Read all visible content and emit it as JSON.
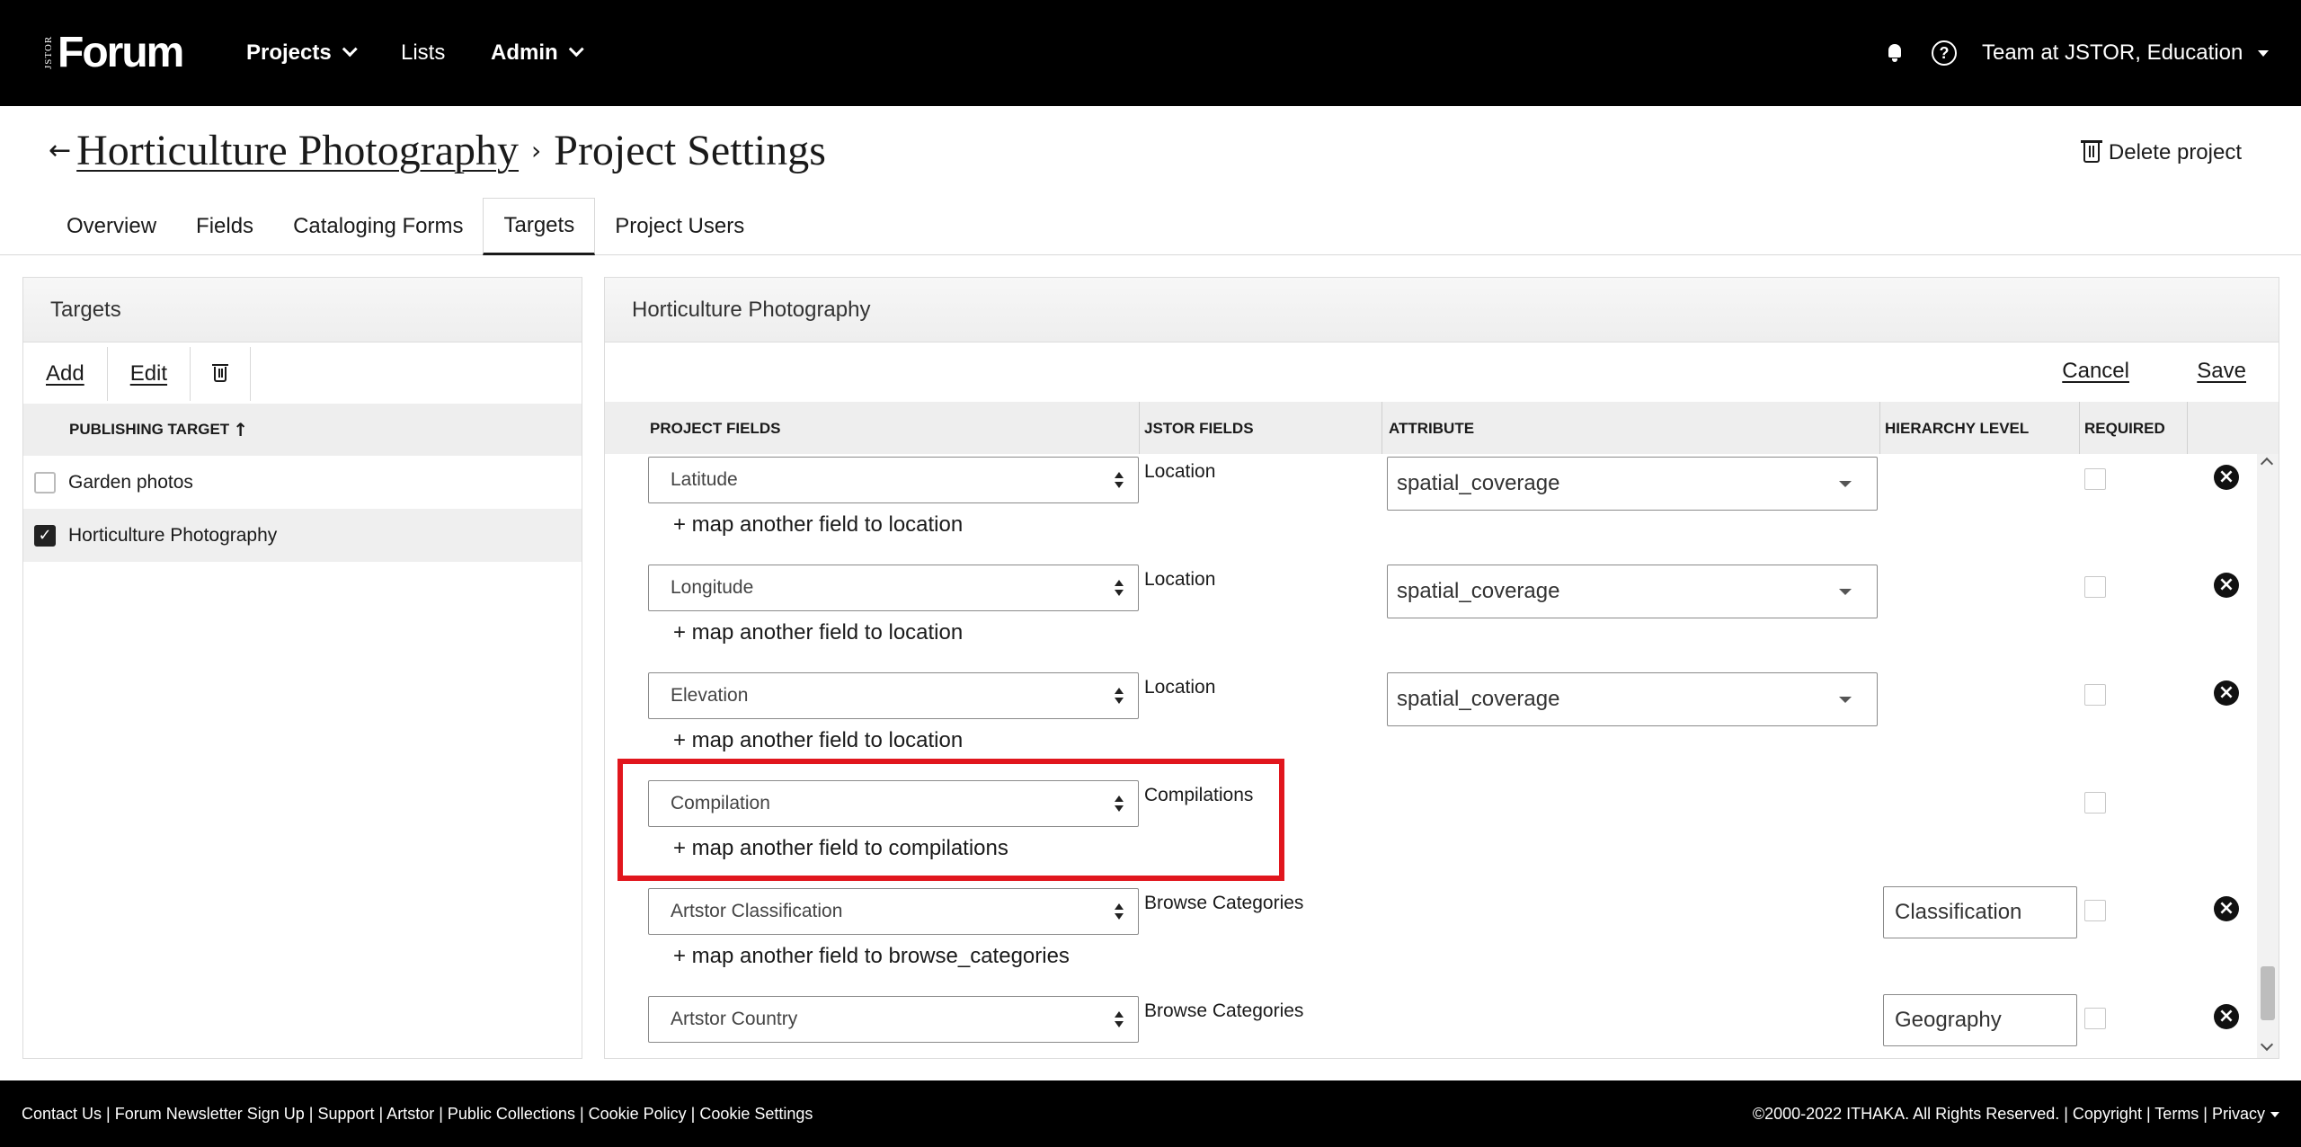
{
  "brand": {
    "small": "JSTOR",
    "main": "Forum"
  },
  "nav": {
    "projects": "Projects",
    "lists": "Lists",
    "admin": "Admin"
  },
  "user": {
    "team": "Team at JSTOR, Education",
    "help_glyph": "?"
  },
  "breadcrumb": {
    "back": "←",
    "project": "Horticulture Photography",
    "separator": "›",
    "current": "Project Settings"
  },
  "delete_project": "Delete project",
  "tabs": [
    "Overview",
    "Fields",
    "Cataloging Forms",
    "Targets",
    "Project Users"
  ],
  "active_tab": "Targets",
  "left_panel": {
    "title": "Targets",
    "toolbar": {
      "add": "Add",
      "edit": "Edit",
      "delete_icon": "trash-icon"
    },
    "column": "PUBLISHING TARGET",
    "sort_glyph": "↑",
    "rows": [
      {
        "label": "Garden photos",
        "checked": false
      },
      {
        "label": "Horticulture Photography",
        "checked": true
      }
    ]
  },
  "right_panel": {
    "title": "Horticulture Photography",
    "cancel": "Cancel",
    "save": "Save",
    "columns": {
      "project_fields": "PROJECT FIELDS",
      "jstor_fields": "JSTOR FIELDS",
      "attribute": "ATTRIBUTE",
      "hierarchy_level": "HIERARCHY LEVEL",
      "required": "REQUIRED"
    },
    "rows": [
      {
        "project_field": "Latitude",
        "jstor_field": "Location",
        "attribute": "spatial_coverage",
        "hierarchy": "",
        "map_link": "+ map another field to location",
        "removable": true
      },
      {
        "project_field": "Longitude",
        "jstor_field": "Location",
        "attribute": "spatial_coverage",
        "hierarchy": "",
        "map_link": "+ map another field to location",
        "removable": true
      },
      {
        "project_field": "Elevation",
        "jstor_field": "Location",
        "attribute": "spatial_coverage",
        "hierarchy": "",
        "map_link": "+ map another field to location",
        "removable": true
      },
      {
        "project_field": "Compilation",
        "jstor_field": "Compilations",
        "attribute": "",
        "hierarchy": "",
        "map_link": "+ map another field to compilations",
        "removable": false
      },
      {
        "project_field": "Artstor Classification",
        "jstor_field": "Browse Categories",
        "attribute": "",
        "hierarchy": "Classification",
        "map_link": "+ map another field to browse_categories",
        "removable": true
      },
      {
        "project_field": "Artstor Country",
        "jstor_field": "Browse Categories",
        "attribute": "",
        "hierarchy": "Geography",
        "map_link": "",
        "removable": true
      }
    ],
    "remove_glyph": "×"
  },
  "footer": {
    "left": "Contact Us | Forum Newsletter Sign Up | Support | Artstor | Public Collections | Cookie Policy |  Cookie Settings",
    "right": "©2000-2022 ITHAKA. All Rights Reserved. | Copyright | Terms | Privacy"
  },
  "colors": {
    "highlight": "#e1161d",
    "topbar": "#000000",
    "footer": "#000000"
  }
}
